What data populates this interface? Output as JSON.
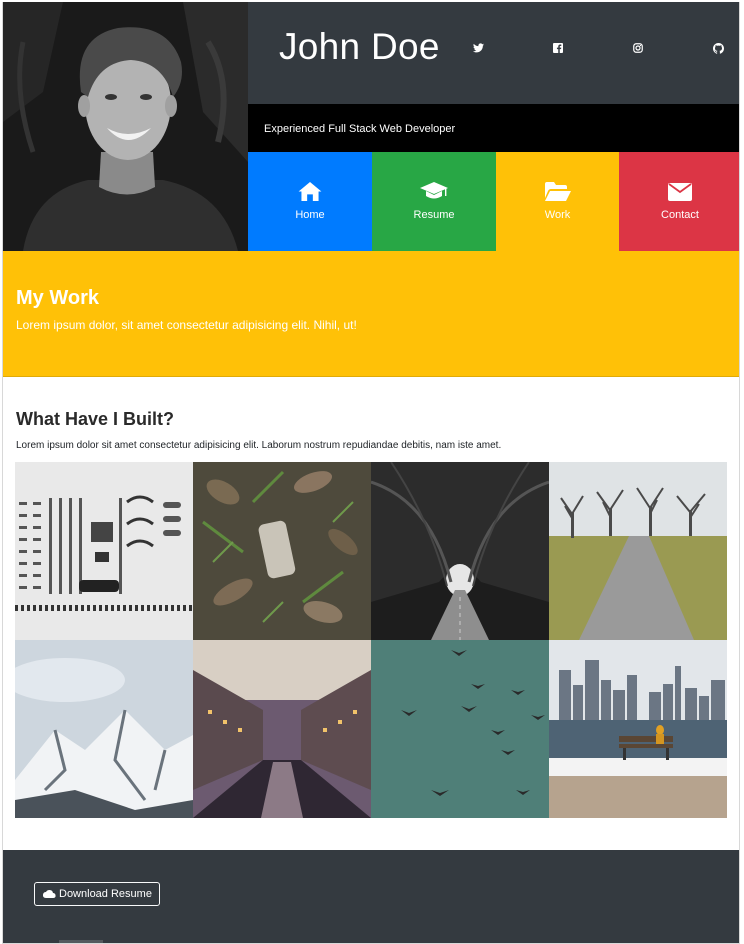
{
  "header": {
    "name": "John Doe",
    "tagline": "Experienced Full Stack Web Developer",
    "portrait_icon": "person-photo",
    "socials": [
      {
        "icon": "twitter-icon"
      },
      {
        "icon": "facebook-icon"
      },
      {
        "icon": "instagram-icon"
      },
      {
        "icon": "github-icon"
      }
    ]
  },
  "nav": {
    "home": {
      "label": "Home",
      "icon": "home-icon",
      "color": "#007bff"
    },
    "resume": {
      "label": "Resume",
      "icon": "graduation-cap-icon",
      "color": "#28a745"
    },
    "work": {
      "label": "Work",
      "icon": "folder-open-icon",
      "color": "#ffc107"
    },
    "contact": {
      "label": "Contact",
      "icon": "envelope-icon",
      "color": "#dc3545"
    }
  },
  "banner": {
    "title": "My Work",
    "subtitle": "Lorem ipsum dolor, sit amet consectetur adipisicing elit. Nihil, ut!",
    "color": "#ffc107"
  },
  "work": {
    "title": "What Have I Built?",
    "description": "Lorem ipsum dolor sit amet consectetur adipisicing elit. Laborum nostrum repudiandae debitis, nam iste amet.",
    "gallery": [
      {
        "subject": "typewriter-parts"
      },
      {
        "subject": "leaves-on-ground"
      },
      {
        "subject": "tree-tunnel-road"
      },
      {
        "subject": "park-path-trees"
      },
      {
        "subject": "snowy-mountains"
      },
      {
        "subject": "canal-city"
      },
      {
        "subject": "birds-in-sky"
      },
      {
        "subject": "city-skyline-bench"
      }
    ]
  },
  "footer": {
    "download_label": "Download Resume",
    "download_icon": "cloud-icon"
  },
  "colors": {
    "dark": "#343a40",
    "black": "#000000",
    "primary": "#007bff",
    "success": "#28a745",
    "warning": "#ffc107",
    "danger": "#dc3545"
  }
}
